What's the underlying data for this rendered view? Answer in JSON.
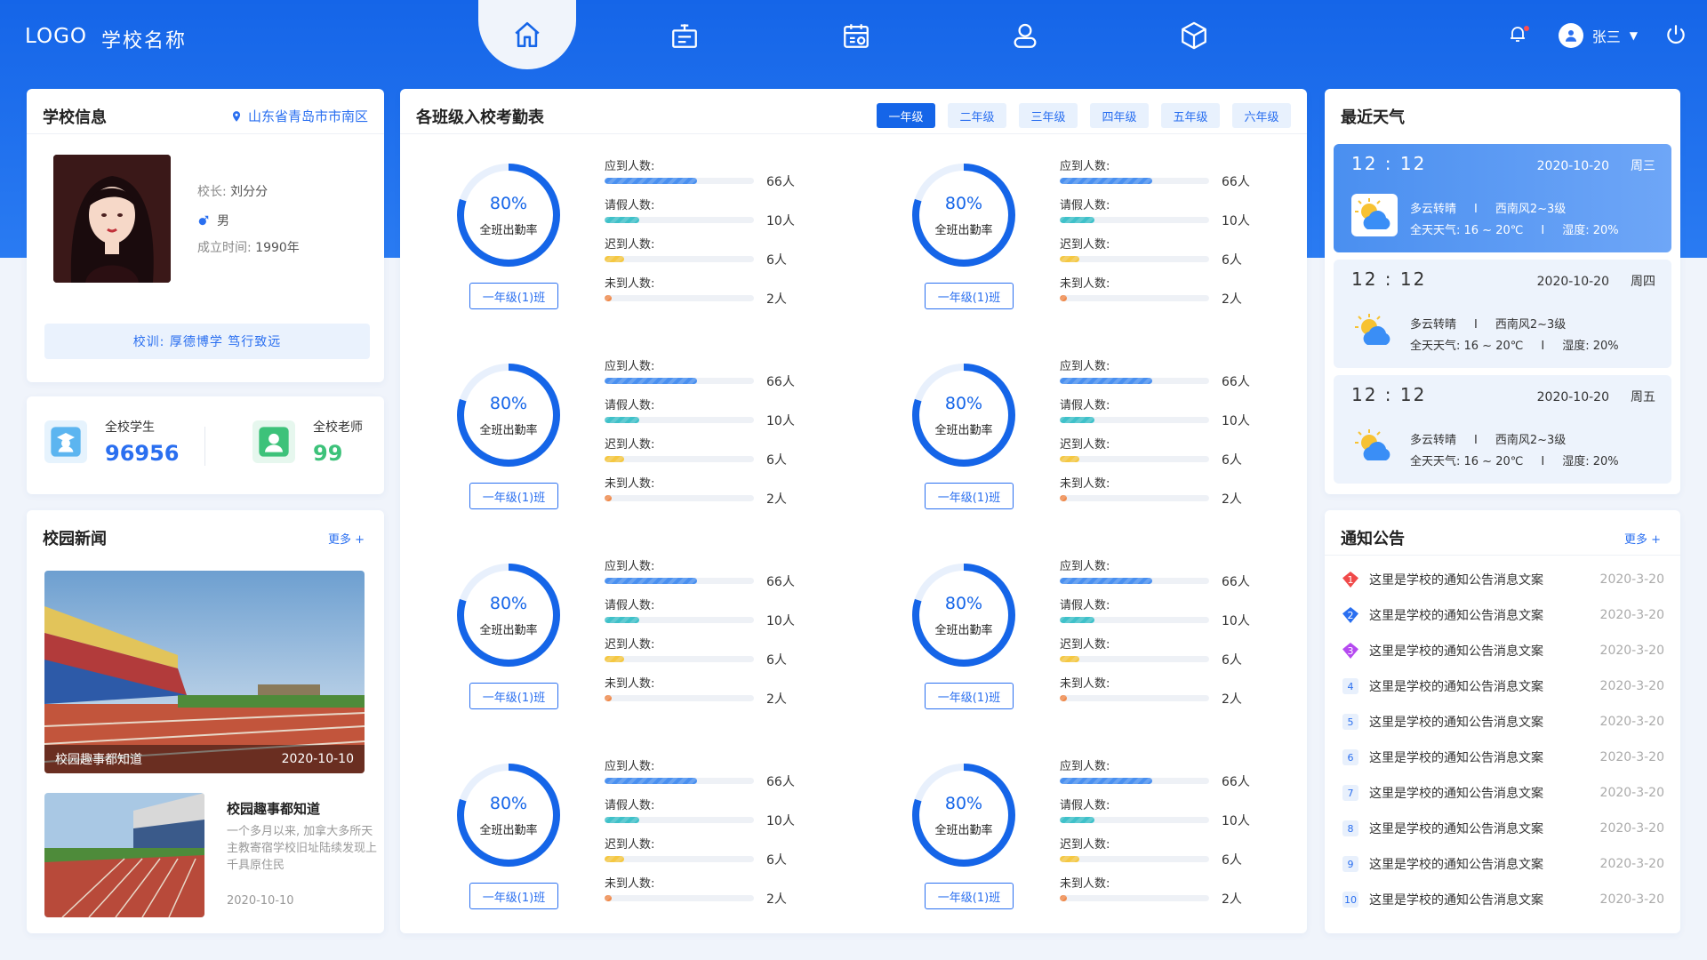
{
  "header": {
    "logo": "LOGO",
    "school_name": "学校名称",
    "user_name": "张三",
    "nav": [
      "home-icon",
      "classroom-icon",
      "schedule-icon",
      "profile-icon",
      "cube-icon"
    ]
  },
  "school_info": {
    "title": "学校信息",
    "location": "山东省青岛市市南区",
    "principal_label": "校长:",
    "principal": "刘分分",
    "gender": "男",
    "founded_label": "成立时间:",
    "founded": "1990年",
    "motto": "校训: 厚德博学  笃行致远"
  },
  "stats": {
    "students_label": "全校学生",
    "students": "96956",
    "teachers_label": "全校老师",
    "teachers": "99"
  },
  "news": {
    "title": "校园新闻",
    "more": "更多 +",
    "featured": {
      "caption": "校园趣事都知道",
      "date": "2020-10-10"
    },
    "item": {
      "title": "校园趣事都知道",
      "desc": "一个多月以来, 加拿大多所天主教寄宿学校旧址陆续发现上千具原住民",
      "date": "2020-10-10"
    }
  },
  "attendance": {
    "title": "各班级入校考勤表",
    "grades": [
      "一年级",
      "二年级",
      "三年级",
      "四年级",
      "五年级",
      "六年级"
    ],
    "active_grade": 0,
    "row_labels": [
      "应到人数:",
      "请假人数:",
      "迟到人数:",
      "未到人数:"
    ],
    "classes": [
      {
        "pct": "80%",
        "label": "全班出勤率",
        "name": "一年级(1)班",
        "values": [
          "66人",
          "10人",
          "6人",
          "2人"
        ]
      },
      {
        "pct": "80%",
        "label": "全班出勤率",
        "name": "一年级(1)班",
        "values": [
          "66人",
          "10人",
          "6人",
          "2人"
        ]
      },
      {
        "pct": "80%",
        "label": "全班出勤率",
        "name": "一年级(1)班",
        "values": [
          "66人",
          "10人",
          "6人",
          "2人"
        ]
      },
      {
        "pct": "80%",
        "label": "全班出勤率",
        "name": "一年级(1)班",
        "values": [
          "66人",
          "10人",
          "6人",
          "2人"
        ]
      },
      {
        "pct": "80%",
        "label": "全班出勤率",
        "name": "一年级(1)班",
        "values": [
          "66人",
          "10人",
          "6人",
          "2人"
        ]
      },
      {
        "pct": "80%",
        "label": "全班出勤率",
        "name": "一年级(1)班",
        "values": [
          "66人",
          "10人",
          "6人",
          "2人"
        ]
      },
      {
        "pct": "80%",
        "label": "全班出勤率",
        "name": "一年级(1)班",
        "values": [
          "66人",
          "10人",
          "6人",
          "2人"
        ]
      },
      {
        "pct": "80%",
        "label": "全班出勤率",
        "name": "一年级(1)班",
        "values": [
          "66人",
          "10人",
          "6人",
          "2人"
        ]
      }
    ],
    "bar_colors": [
      "#4a90f0",
      "#3fc1c9",
      "#f5c842",
      "#f08a4b"
    ]
  },
  "weather": {
    "title": "最近天气",
    "days": [
      {
        "time": "12 : 12",
        "date": "2020-10-20",
        "weekday": "周三",
        "cond": "多云转晴",
        "wind": "西南风2~3级",
        "temp": "全天天气: 16 ~ 20℃",
        "humidity": "湿度: 20%"
      },
      {
        "time": "12 : 12",
        "date": "2020-10-20",
        "weekday": "周四",
        "cond": "多云转晴",
        "wind": "西南风2~3级",
        "temp": "全天天气: 16 ~ 20℃",
        "humidity": "湿度: 20%"
      },
      {
        "time": "12 : 12",
        "date": "2020-10-20",
        "weekday": "周五",
        "cond": "多云转晴",
        "wind": "西南风2~3级",
        "temp": "全天天气: 16 ~ 20℃",
        "humidity": "湿度: 20%"
      }
    ]
  },
  "notices": {
    "title": "通知公告",
    "more": "更多 +",
    "items": [
      {
        "rank": "1",
        "text": "这里是学校的通知公告消息文案",
        "date": "2020-3-20"
      },
      {
        "rank": "2",
        "text": "这里是学校的通知公告消息文案",
        "date": "2020-3-20"
      },
      {
        "rank": "3",
        "text": "这里是学校的通知公告消息文案",
        "date": "2020-3-20"
      },
      {
        "rank": "4",
        "text": "这里是学校的通知公告消息文案",
        "date": "2020-3-20"
      },
      {
        "rank": "5",
        "text": "这里是学校的通知公告消息文案",
        "date": "2020-3-20"
      },
      {
        "rank": "6",
        "text": "这里是学校的通知公告消息文案",
        "date": "2020-3-20"
      },
      {
        "rank": "7",
        "text": "这里是学校的通知公告消息文案",
        "date": "2020-3-20"
      },
      {
        "rank": "8",
        "text": "这里是学校的通知公告消息文案",
        "date": "2020-3-20"
      },
      {
        "rank": "9",
        "text": "这里是学校的通知公告消息文案",
        "date": "2020-3-20"
      },
      {
        "rank": "10",
        "text": "这里是学校的通知公告消息文案",
        "date": "2020-3-20"
      }
    ]
  }
}
